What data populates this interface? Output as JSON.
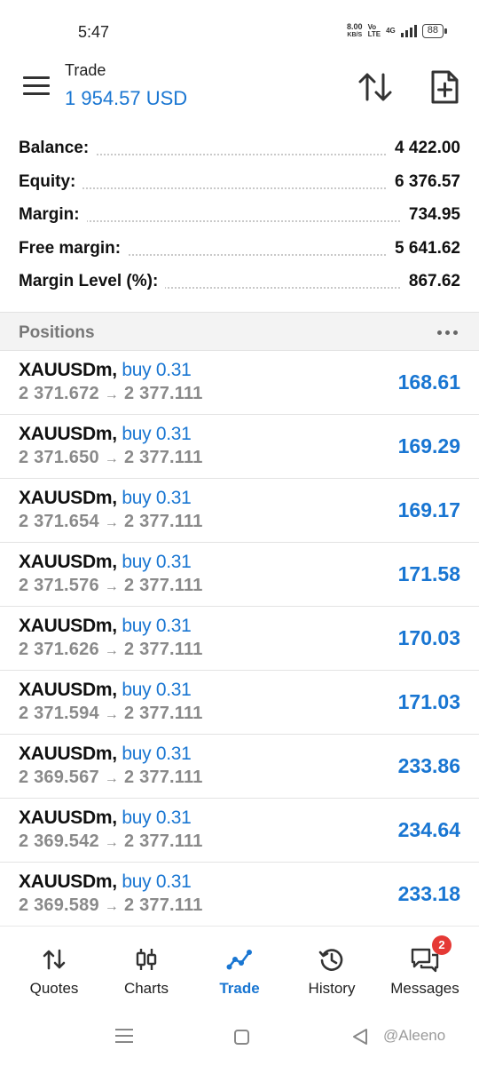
{
  "status_bar": {
    "time": "5:47",
    "speed_value": "8.00",
    "speed_unit": "KB/S",
    "network_top": "Vo",
    "network_bottom": "LTE",
    "network_type": "4G",
    "battery": "88"
  },
  "header": {
    "title": "Trade",
    "balance": "1 954.57 USD",
    "menu_icon": "hamburger-menu-icon",
    "sort_icon": "sort-arrows-icon",
    "new_order_icon": "add-document-icon"
  },
  "summary": [
    {
      "label": "Balance:",
      "value": "4 422.00"
    },
    {
      "label": "Equity:",
      "value": "6 376.57"
    },
    {
      "label": "Margin:",
      "value": "734.95"
    },
    {
      "label": "Free margin:",
      "value": "5 641.62"
    },
    {
      "label": "Margin Level (%):",
      "value": "867.62"
    }
  ],
  "positions_header": {
    "title": "Positions",
    "more_icon": "more-dots-icon"
  },
  "positions": [
    {
      "symbol": "XAUUSDm,",
      "side": "buy 0.31",
      "open": "2 371.672",
      "arrow": "→",
      "current": "2 377.111",
      "profit": "168.61"
    },
    {
      "symbol": "XAUUSDm,",
      "side": "buy 0.31",
      "open": "2 371.650",
      "arrow": "→",
      "current": "2 377.111",
      "profit": "169.29"
    },
    {
      "symbol": "XAUUSDm,",
      "side": "buy 0.31",
      "open": "2 371.654",
      "arrow": "→",
      "current": "2 377.111",
      "profit": "169.17"
    },
    {
      "symbol": "XAUUSDm,",
      "side": "buy 0.31",
      "open": "2 371.576",
      "arrow": "→",
      "current": "2 377.111",
      "profit": "171.58"
    },
    {
      "symbol": "XAUUSDm,",
      "side": "buy 0.31",
      "open": "2 371.626",
      "arrow": "→",
      "current": "2 377.111",
      "profit": "170.03"
    },
    {
      "symbol": "XAUUSDm,",
      "side": "buy 0.31",
      "open": "2 371.594",
      "arrow": "→",
      "current": "2 377.111",
      "profit": "171.03"
    },
    {
      "symbol": "XAUUSDm,",
      "side": "buy 0.31",
      "open": "2 369.567",
      "arrow": "→",
      "current": "2 377.111",
      "profit": "233.86"
    },
    {
      "symbol": "XAUUSDm,",
      "side": "buy 0.31",
      "open": "2 369.542",
      "arrow": "→",
      "current": "2 377.111",
      "profit": "234.64"
    },
    {
      "symbol": "XAUUSDm,",
      "side": "buy 0.31",
      "open": "2 369.589",
      "arrow": "→",
      "current": "2 377.111",
      "profit": "233.18"
    }
  ],
  "bottom_nav": [
    {
      "label": "Quotes",
      "icon": "quotes-arrows-icon"
    },
    {
      "label": "Charts",
      "icon": "candlestick-icon"
    },
    {
      "label": "Trade",
      "icon": "trade-line-icon",
      "active": true
    },
    {
      "label": "History",
      "icon": "history-clock-icon"
    },
    {
      "label": "Messages",
      "icon": "messages-chat-icon",
      "badge": "2"
    }
  ],
  "watermark": "@Aleeno",
  "colors": {
    "accent": "#1976d2",
    "badge": "#e53935",
    "muted": "#8a8a8a"
  }
}
